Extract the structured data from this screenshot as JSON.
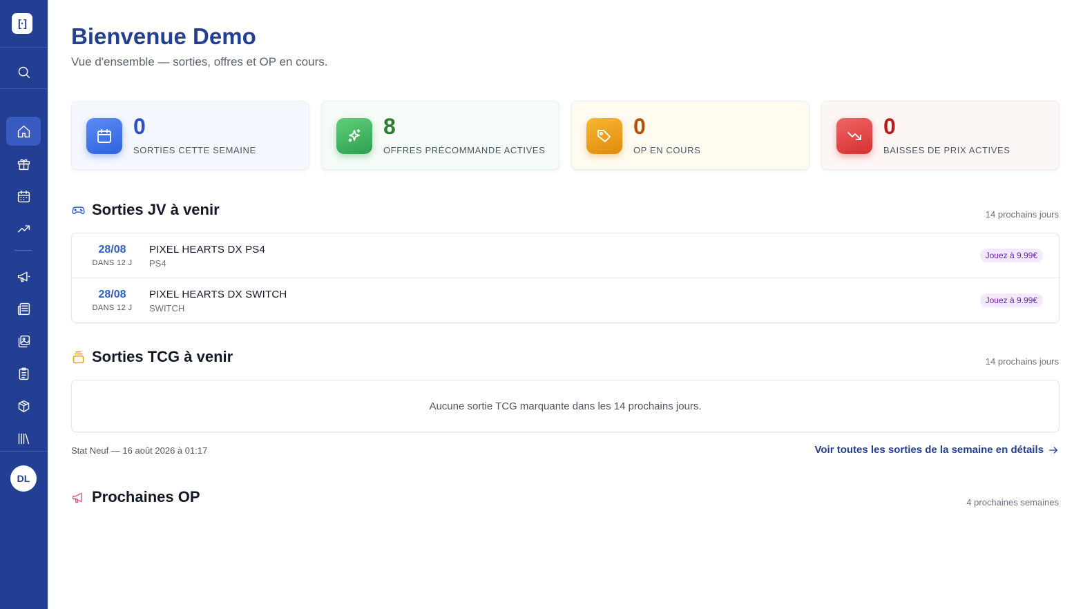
{
  "sidebar": {
    "logo_text": "[·]",
    "avatar_initials": "DL",
    "items": [
      {
        "icon": "search-icon"
      },
      {
        "icon": "home-icon",
        "active": true
      },
      {
        "icon": "gift-icon"
      },
      {
        "icon": "calendar-icon"
      },
      {
        "icon": "trending-up-icon"
      },
      {
        "icon": "megaphone-icon"
      },
      {
        "icon": "newspaper-icon"
      },
      {
        "icon": "images-icon"
      },
      {
        "icon": "clipboard-icon"
      },
      {
        "icon": "package-icon"
      },
      {
        "icon": "library-icon"
      }
    ]
  },
  "header": {
    "title": "Bienvenue Demo",
    "subtitle": "Vue d'ensemble — sorties, offres et OP en cours."
  },
  "stats": [
    {
      "value": "0",
      "label": "SORTIES CETTE SEMAINE",
      "icon": "calendar-icon",
      "color": "#2b50c7"
    },
    {
      "value": "8",
      "label": "OFFRES PRÉCOMMANDE ACTIVES",
      "icon": "sparkles-icon",
      "color": "#2e7d32"
    },
    {
      "value": "0",
      "label": "OP EN COURS",
      "icon": "tag-icon",
      "color": "#b45309"
    },
    {
      "value": "0",
      "label": "BAISSES DE PRIX ACTIVES",
      "icon": "trending-down-icon",
      "color": "#b91c1c"
    }
  ],
  "jv": {
    "title": "Sorties JV à venir",
    "range": "14 prochains jours",
    "rows": [
      {
        "date": "28/08",
        "in": "DANS 12 J",
        "name": "PIXEL HEARTS DX PS4",
        "platform": "PS4",
        "badge": "Jouez à 9.99€"
      },
      {
        "date": "28/08",
        "in": "DANS 12 J",
        "name": "PIXEL HEARTS DX SWITCH",
        "platform": "SWITCH",
        "badge": "Jouez à 9.99€"
      }
    ]
  },
  "tcg": {
    "title": "Sorties TCG à venir",
    "range": "14 prochains jours",
    "empty": "Aucune sortie TCG marquante dans les 14 prochains jours."
  },
  "footer": {
    "stat": "Stat Neuf — 16 août 2026 à 01:17",
    "link": "Voir toutes les sorties de la semaine en détails"
  },
  "op": {
    "title": "Prochaines OP",
    "range": "4 prochaines semaines"
  }
}
